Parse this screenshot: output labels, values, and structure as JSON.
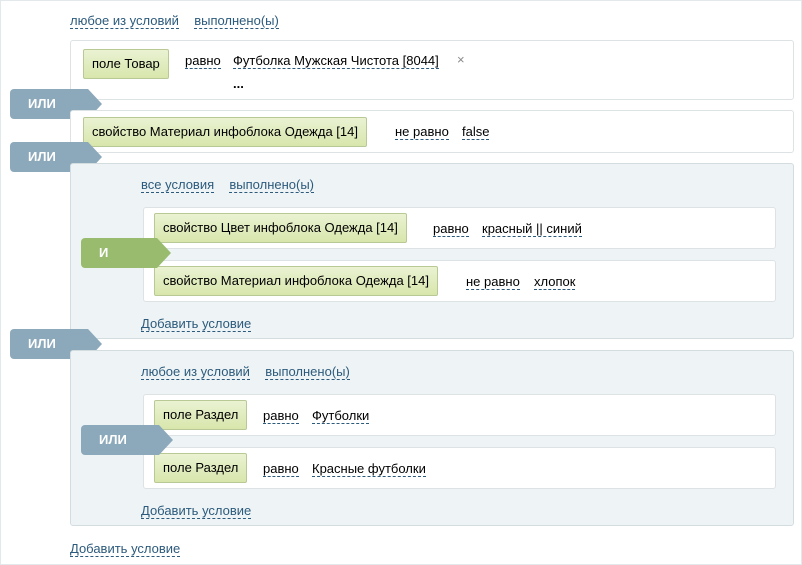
{
  "root": {
    "header": {
      "any_label": "любое из условий",
      "done_label": "выполнено(ы)"
    },
    "add_label": "Добавить условие",
    "or_label": "ИЛИ",
    "rows": [
      {
        "field": "поле Товар",
        "operator": "равно",
        "value": "Футболка Мужская Чистота [8044]",
        "more": "...",
        "delete": "×"
      },
      {
        "field": "свойство Материал инфоблока Одежда [14]",
        "operator": "не равно",
        "value": "false"
      }
    ]
  },
  "group_and": {
    "header": {
      "all_label": "все условия",
      "done_label": "выполнено(ы)"
    },
    "logic_label": "И",
    "rows": [
      {
        "field": "свойство Цвет инфоблока Одежда [14]",
        "operator": "равно",
        "value": "красный || синий"
      },
      {
        "field": "свойство Материал инфоблока Одежда [14]",
        "operator": "не равно",
        "value": "хлопок"
      }
    ],
    "add_label": "Добавить условие"
  },
  "group_or": {
    "header": {
      "any_label": "любое из условий",
      "done_label": "выполнено(ы)"
    },
    "logic_label": "ИЛИ",
    "rows": [
      {
        "field": "поле Раздел",
        "operator": "равно",
        "value": "Футболки"
      },
      {
        "field": "поле Раздел",
        "operator": "равно",
        "value": "Красные футболки"
      }
    ],
    "add_label": "Добавить условие"
  },
  "colors": {
    "link": "#2c5a7c",
    "or_connector": "#8ca8bb",
    "and_connector": "#99bb6e",
    "field_bg": "#dce8b4"
  }
}
